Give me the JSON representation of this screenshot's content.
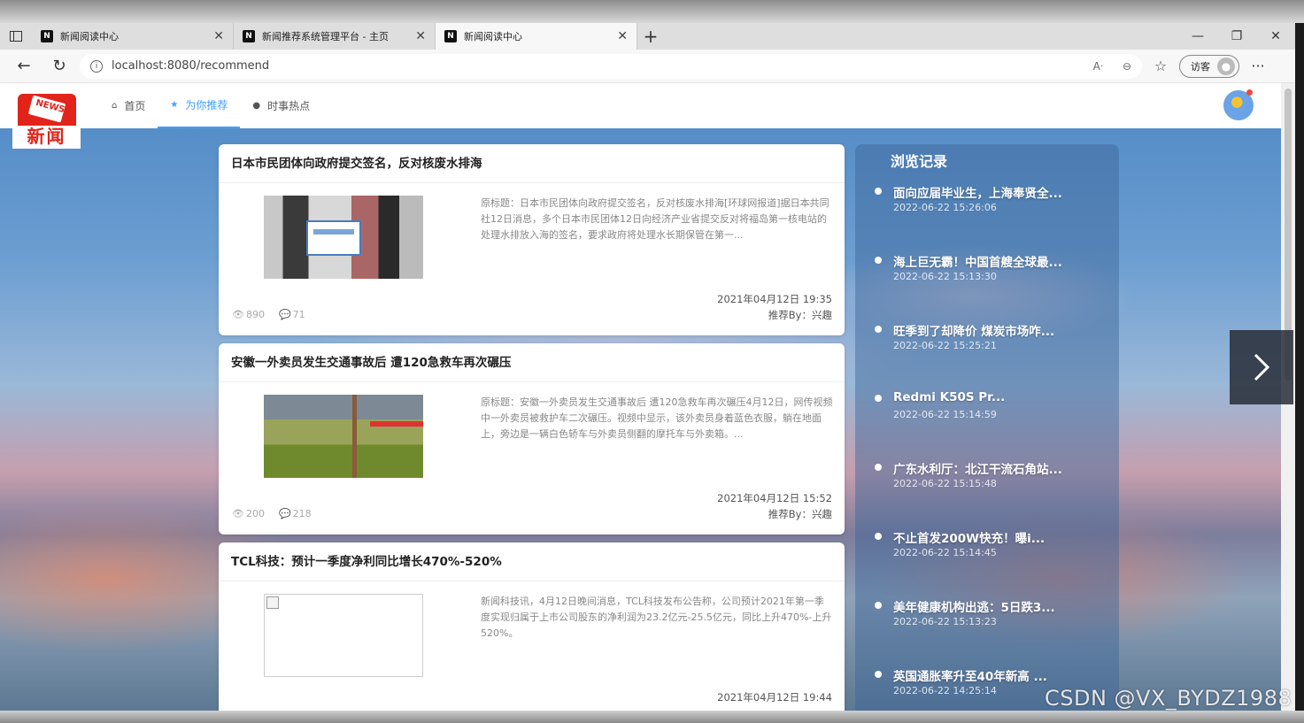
{
  "browser": {
    "tabs": [
      {
        "favicon": "N",
        "title": "新闻阅读中心"
      },
      {
        "favicon": "N",
        "title": "新闻推荐系统管理平台 - 主页"
      },
      {
        "favicon": "N",
        "title": "新闻阅读中心"
      }
    ],
    "url": "localhost:8080/recommend",
    "guest_label": "访客"
  },
  "site": {
    "logo_text": "新闻",
    "logo_mark": "NEWS",
    "nav": [
      {
        "label": "首页",
        "icon": "home-icon"
      },
      {
        "label": "为你推荐",
        "icon": "star-icon"
      },
      {
        "label": "时事热点",
        "icon": "fire-icon"
      }
    ]
  },
  "news": [
    {
      "title": "日本市民团体向政府提交签名，反对核废水排海",
      "summary": "原标题：日本市民团体向政府提交签名，反对核废水排海[环球网报道]据日本共同社12日消息，多个日本市民团体12日向经济产业省提交反对将福岛第一核电站的处理水排放入海的签名，要求政府将处理水长期保管在第一...",
      "views": "890",
      "comments": "71",
      "date": "2021年04月12日 19:35",
      "recommended_by": "推荐By：兴趣"
    },
    {
      "title": "安徽一外卖员发生交通事故后 遭120急救车再次碾压",
      "summary": "原标题：安徽一外卖员发生交通事故后 遭120急救车再次碾压4月12日，网传视频中一外卖员被救护车二次碾压。视频中显示，该外卖员身着蓝色衣服，躺在地面上，旁边是一辆白色轿车与外卖员侧翻的摩托车与外卖箱。...",
      "views": "200",
      "comments": "218",
      "date": "2021年04月12日 15:52",
      "recommended_by": "推荐By：兴趣"
    },
    {
      "title": "TCL科技：预计一季度净利同比增长470%-520%",
      "summary": "新闻科技讯，4月12日晚间消息，TCL科技发布公告称，公司预计2021年第一季度实现归属于上市公司股东的净利润为23.2亿元-25.5亿元，同比上升470%-上升520%。",
      "date": "2021年04月12日 19:44"
    }
  ],
  "history": {
    "title": "浏览记录",
    "items": [
      {
        "name": "面向应届毕业生，上海奉贤全...",
        "time": "2022-06-22 15:26:06"
      },
      {
        "name": "海上巨无霸！中国首艘全球最...",
        "time": "2022-06-22 15:13:30"
      },
      {
        "name": "旺季到了却降价 煤炭市场咋...",
        "time": "2022-06-22 15:25:21"
      },
      {
        "name": "Redmi K50S Pr...",
        "time": "2022-06-22 15:14:59"
      },
      {
        "name": "广东水利厅：北江干流石角站...",
        "time": "2022-06-22 15:15:48"
      },
      {
        "name": "不止首发200W快充！曝i...",
        "time": "2022-06-22 15:14:45"
      },
      {
        "name": "美年健康机构出逃：5日跌3...",
        "time": "2022-06-22 15:13:23"
      },
      {
        "name": "英国通胀率升至40年新高 ...",
        "time": "2022-06-22 14:25:14"
      }
    ]
  },
  "watermark": "CSDN @VX_BYDZ1988"
}
